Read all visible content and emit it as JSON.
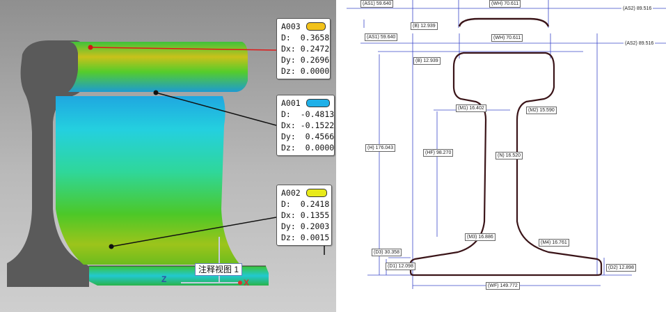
{
  "left_view": {
    "callouts": [
      {
        "id": "A003",
        "swatch": "#f2c21a",
        "rows": [
          [
            "D:",
            "0.3658"
          ],
          [
            "Dx:",
            "0.2472"
          ],
          [
            "Dy:",
            "0.2696"
          ],
          [
            "Dz:",
            "0.0000"
          ]
        ]
      },
      {
        "id": "A001",
        "swatch": "#1fb0e8",
        "rows": [
          [
            "D:",
            "-0.4813"
          ],
          [
            "Dx:",
            "-0.1522"
          ],
          [
            "Dy:",
            "0.4566"
          ],
          [
            "Dz:",
            "0.0000"
          ]
        ]
      },
      {
        "id": "A002",
        "swatch": "#e8ea1a",
        "rows": [
          [
            "D:",
            "0.2418"
          ],
          [
            "Dx:",
            "0.1355"
          ],
          [
            "Dy:",
            "0.2003"
          ],
          [
            "Dz:",
            "0.0015"
          ]
        ]
      }
    ],
    "view_label": "注释视图 1",
    "axis_z": "Z",
    "axis_x": "X"
  },
  "drawing": {
    "top_labels": {
      "as1": "(AS1) 59.640",
      "wh": "(WH) 70.611",
      "as2": "(AS2) 89.516",
      "b": "(B) 12.939"
    },
    "labels": {
      "as1": "(AS1) 59.640",
      "wh": "(WH) 70.611",
      "as2": "(AS2) 89.516",
      "b": "(B) 12.939",
      "m1": "(M1) 16.402",
      "m2": "(M2) 15.590",
      "h": "(H) 176.043",
      "hf": "(HF) 98.270",
      "n": "(N) 16.520",
      "m3": "(M3) 16.886",
      "m4": "(M4) 16.761",
      "d3": "(D3) 30.358",
      "d1": "(D1) 12.098",
      "d2": "(D2) 12.898",
      "wf": "(WF) 149.772"
    }
  }
}
